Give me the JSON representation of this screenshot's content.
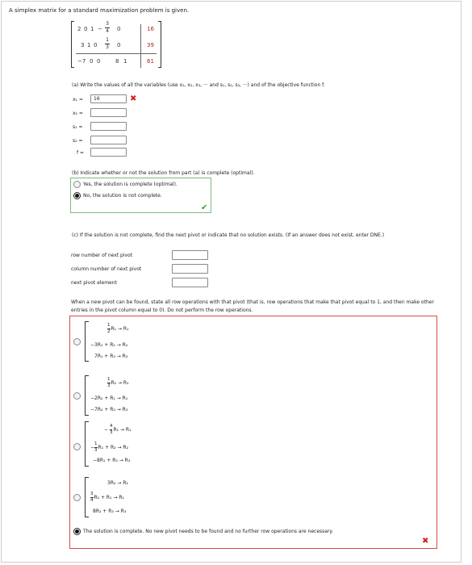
{
  "prompt": "A simplex matrix for a standard maximization problem is given.",
  "matrix": {
    "r1": [
      "2",
      "0",
      "1",
      "−",
      "3",
      "4",
      "0",
      "16"
    ],
    "r2": [
      "3",
      "1",
      "0",
      "1",
      "3",
      "0",
      "39"
    ],
    "r3": [
      "−7",
      "0",
      "0",
      "8",
      "1",
      "61"
    ]
  },
  "part_a": {
    "question": "(a) Write the values of all the variables (use x₁, x₂, x₃, ··· and s₁, s₂, s₃, ···) and of the objective function f.",
    "labels": [
      "x₁ =",
      "x₂ =",
      "s₁ =",
      "s₂ =",
      "f ="
    ],
    "values": [
      "16",
      "",
      "",
      "",
      ""
    ],
    "x1_mark": "✖"
  },
  "part_b": {
    "question": "(b) Indicate whether or not the solution from part (a) is complete (optimal).",
    "options": [
      "Yes, the solution is complete (optimal).",
      "No, the solution is not complete."
    ],
    "selected": 1,
    "mark": "✔"
  },
  "part_c": {
    "question": "(c) If the solution is not complete, find the next pivot or indicate that no solution exists. (If an answer does not exist, enter DNE.)",
    "labels": [
      "row number of next pivot",
      "column number of next pivot",
      "next pivot element"
    ]
  },
  "part_d": {
    "question": "When a new pivot can be found, state all row operations with that pivot (that is, row operations that make that pivot equal to 1, and then make other entries in the pivot column equal to 0). Do not perform the row operations.",
    "opt1": {
      "f_num": "1",
      "f_den": "2",
      "l1": "R₁ → R₁",
      "l2": "−3R₁ + R₂ → R₂",
      "l3": "7R₁ + R₃ → R₃"
    },
    "opt2": {
      "f_num": "1",
      "f_den": "3",
      "l1": "R₂ → R₂",
      "l2": "−2R₂ + R₁ → R₁",
      "l3": "−7R₂ + R₃ → R₃"
    },
    "opt3": {
      "l1_pre": "−",
      "f1_num": "4",
      "f1_den": "3",
      "l1": "R₁ → R₁",
      "l2_pre": "−",
      "f2_num": "1",
      "f2_den": "3",
      "l2": "R₁ + R₂ → R₂",
      "l3": "−8R₁ + R₃ → R₃"
    },
    "opt4": {
      "l1": "3R₂ → R₂",
      "f_num": "3",
      "f_den": "4",
      "l2": "R₂ + R₁ → R₁",
      "l3": "8R₂ + R₃ → R₃"
    },
    "final_option": "The solution is complete. No new pivot needs to be found and no further row operations are necessary.",
    "mark": "✖"
  }
}
